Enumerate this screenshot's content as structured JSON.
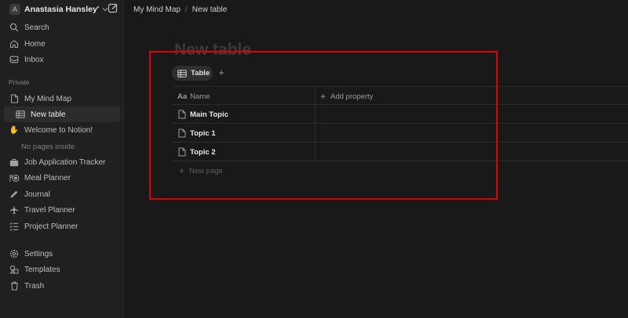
{
  "workspace": {
    "initial": "A",
    "name": "Anastasia Hansley'..."
  },
  "nav_top": [
    {
      "label": "Search",
      "icon": "search-icon"
    },
    {
      "label": "Home",
      "icon": "home-icon"
    },
    {
      "label": "Inbox",
      "icon": "inbox-icon"
    }
  ],
  "section_private": "Private",
  "private_pages": {
    "my_mind_map": "My Mind Map",
    "new_table": "New table",
    "welcome": "Welcome to Notion!",
    "no_pages": "No pages inside",
    "job_tracker": "Job Application Tracker",
    "meal_planner": "Meal Planner",
    "journal": "Journal",
    "travel_planner": "Travel Planner",
    "project_planner": "Project Planner"
  },
  "nav_bottom": {
    "settings": "Settings",
    "templates": "Templates",
    "trash": "Trash"
  },
  "breadcrumb": {
    "parent": "My Mind Map",
    "sep": "/",
    "current": "New table"
  },
  "page": {
    "title": "New table",
    "view_tab": "Table",
    "add_view": "+"
  },
  "table": {
    "name_header_icon": "Aa",
    "name_header": "Name",
    "add_property": "Add property",
    "rows": [
      "Main Topic",
      "Topic 1",
      "Topic 2"
    ],
    "new_page": "New page"
  },
  "colors": {
    "highlight": "#e00000",
    "background": "#191919",
    "sidebar": "#202020"
  }
}
